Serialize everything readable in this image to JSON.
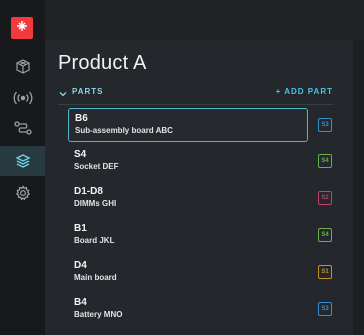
{
  "sidebar": {
    "logo_color": "#f23a3c",
    "items": [
      {
        "icon": "cube-grid-icon",
        "active": false
      },
      {
        "icon": "broadcast-icon",
        "active": false
      },
      {
        "icon": "route-icon",
        "active": false
      },
      {
        "icon": "layers-icon",
        "active": true
      },
      {
        "icon": "settings-icon",
        "active": false
      }
    ]
  },
  "main": {
    "title": "Product A",
    "section_label": "PARTS",
    "add_label": "+ ADD PART",
    "parts": [
      {
        "code": "B6",
        "name": "Sub-assembly board ABC",
        "badge": "S3",
        "badge_color": "#3a8ec8",
        "selected": true
      },
      {
        "code": "S4",
        "name": "Socket DEF",
        "badge": "S4",
        "badge_color": "#6ab04c",
        "selected": false
      },
      {
        "code": "D1-D8",
        "name": "DIMMs GHI",
        "badge": "S2",
        "badge_color": "#c2406a",
        "selected": false
      },
      {
        "code": "B1",
        "name": "Board JKL",
        "badge": "S4",
        "badge_color": "#6ab04c",
        "selected": false
      },
      {
        "code": "D4",
        "name": "Main board",
        "badge": "S1",
        "badge_color": "#c8902a",
        "selected": false
      },
      {
        "code": "B4",
        "name": "Battery MNO",
        "badge": "S3",
        "badge_color": "#3a8ec8",
        "selected": false
      }
    ]
  }
}
